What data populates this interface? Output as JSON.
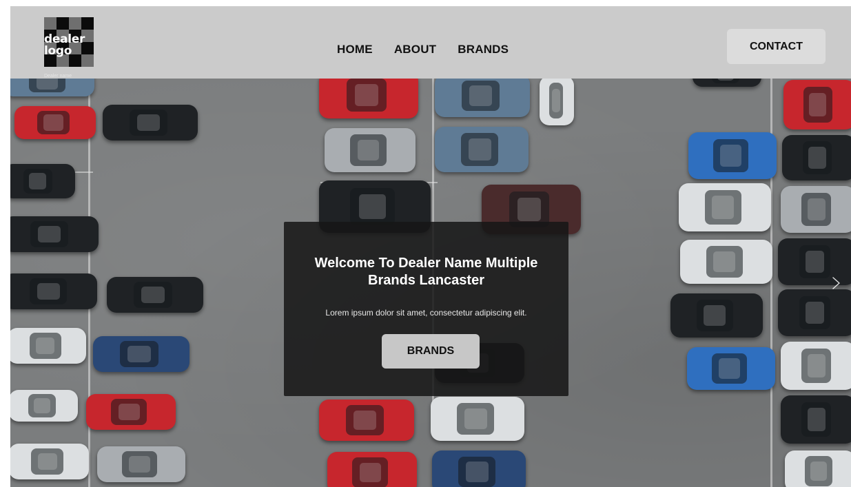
{
  "header": {
    "logo_text": "dealer\nlogo",
    "dealer_name": "Dealer name",
    "nav": [
      {
        "label": "HOME"
      },
      {
        "label": "ABOUT"
      },
      {
        "label": "BRANDS"
      }
    ],
    "contact_label": "CONTACT"
  },
  "hero": {
    "title": "Welcome To Dealer Name Multiple Brands Lancaster",
    "subtitle": "Lorem ipsum dolor sit amet, consectetur adipiscing elit.",
    "button_label": "BRANDS",
    "next_icon": "chevron-right-icon"
  },
  "colors": {
    "header_bg": "#cbcbcb",
    "overlay_bg": "#161616",
    "button_bg": "#c7c7c7"
  }
}
